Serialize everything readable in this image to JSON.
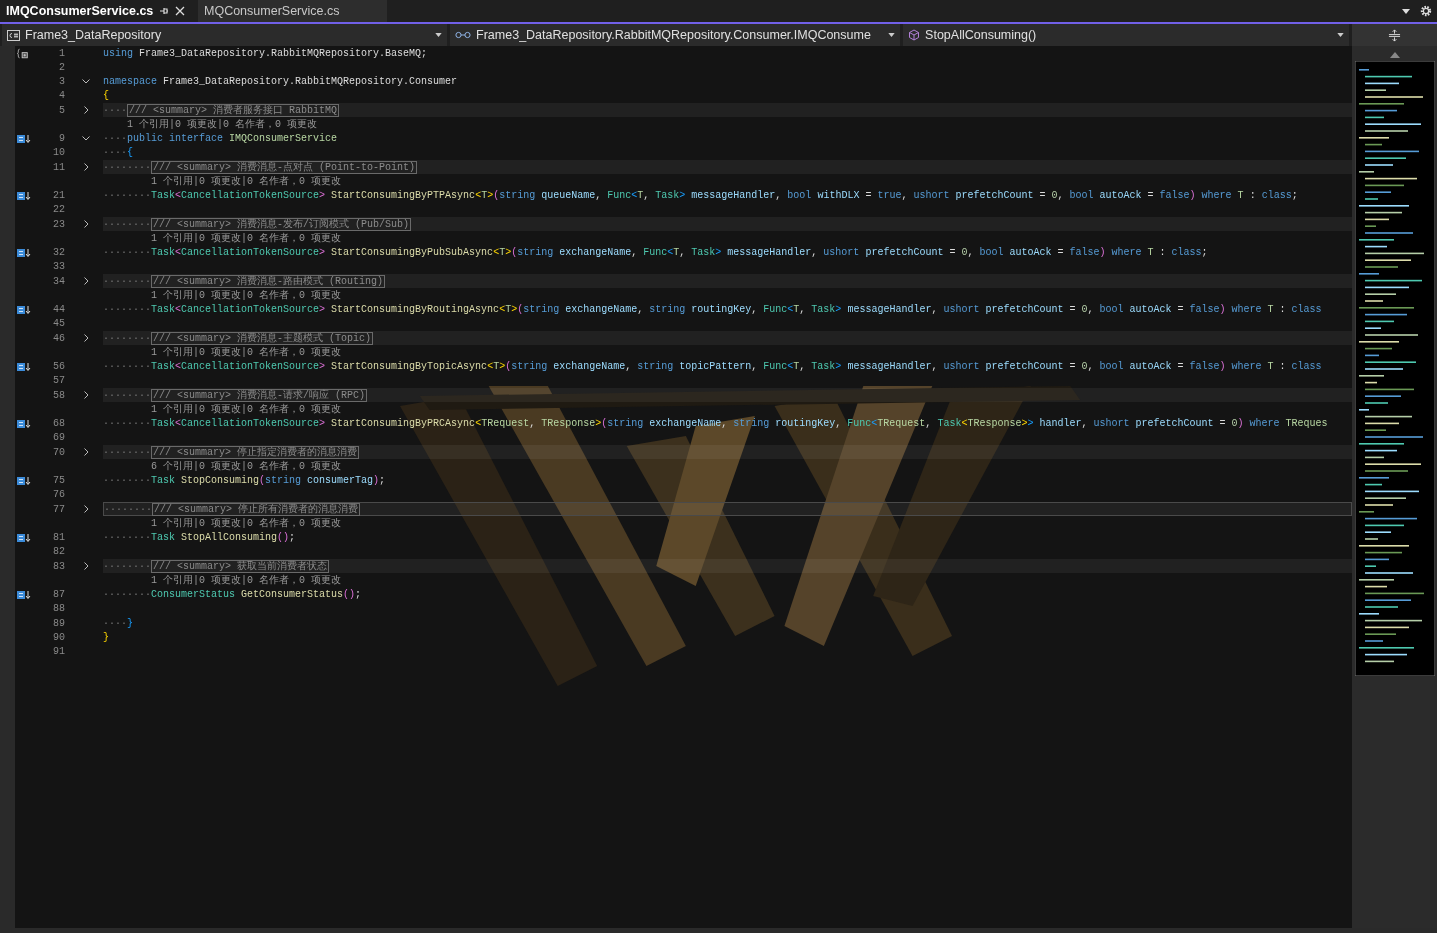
{
  "tabs": [
    {
      "label": "IMQConsumerService.cs",
      "selected": true
    },
    {
      "label": "MQConsumerService.cs",
      "selected": false
    }
  ],
  "navigation": {
    "project": "Frame3_DataRepository",
    "type": "Frame3_DataRepository.RabbitMQRepository.Consumer.IMQConsume",
    "member": "StopAllConsuming()"
  },
  "lines": [
    {
      "number": "1",
      "braces": true,
      "tokens": [
        {
          "text": "using ",
          "kind": "keyword"
        },
        {
          "text": "Frame3_DataRepository.RabbitMQRepository.BaseMQ;",
          "kind": "plain"
        }
      ]
    },
    {
      "number": "2"
    },
    {
      "number": "3",
      "expanded": true,
      "tokens": [
        {
          "text": "namespace ",
          "kind": "keyword"
        },
        {
          "text": "Frame3_DataRepository.RabbitMQRepository.Consumer",
          "kind": "plain"
        }
      ]
    },
    {
      "number": "4",
      "tokens": [
        {
          "text": "{",
          "kind": "gold"
        }
      ]
    },
    {
      "number": "5",
      "expanded": false,
      "tokens": [
        {
          "text": "····",
          "kind": "space"
        },
        {
          "text": "/// <summary> 消费者服务接口 RabbitMQ",
          "kind": "summary"
        }
      ],
      "lens": "1 个引用|0 项更改|0 名作者，0 项更改"
    },
    {
      "number": "9",
      "expanded": true,
      "implementation": true,
      "tokens": [
        {
          "text": "····",
          "kind": "space"
        },
        {
          "text": "public interface ",
          "kind": "keyword"
        },
        {
          "text": "IMQConsumerService",
          "kind": "iface"
        }
      ]
    },
    {
      "number": "10",
      "tokens": [
        {
          "text": "····",
          "kind": "space"
        },
        {
          "text": "{",
          "kind": "blue"
        }
      ]
    },
    {
      "number": "11",
      "expanded": false,
      "tokens": [
        {
          "text": "········",
          "kind": "space"
        },
        {
          "text": "/// <summary> 消费消息-点对点 (Point-to-Point)",
          "kind": "summary"
        }
      ],
      "lens": "1 个引用|0 项更改|0 名作者，0 项更改"
    },
    {
      "number": "21",
      "implementation": true,
      "tokens": [
        {
          "text": "········",
          "kind": "space"
        },
        {
          "text": "Task",
          "kind": "type"
        },
        {
          "text": "<",
          "kind": "pink"
        },
        {
          "text": "CancellationTokenSource",
          "kind": "type"
        },
        {
          "text": "> ",
          "kind": "pink"
        },
        {
          "text": "StartConsumingByPTPAsync",
          "kind": "method"
        },
        {
          "text": "<",
          "kind": "gold"
        },
        {
          "text": "T",
          "kind": "iface"
        },
        {
          "text": ">",
          "kind": "gold"
        },
        {
          "text": "(",
          "kind": "pink"
        },
        {
          "text": "string ",
          "kind": "keyword"
        },
        {
          "text": "queueName",
          "kind": "param"
        },
        {
          "text": ", ",
          "kind": "plain"
        },
        {
          "text": "Func",
          "kind": "type"
        },
        {
          "text": "<",
          "kind": "blue"
        },
        {
          "text": "T",
          "kind": "iface"
        },
        {
          "text": ", ",
          "kind": "plain"
        },
        {
          "text": "Task",
          "kind": "type"
        },
        {
          "text": "> ",
          "kind": "blue"
        },
        {
          "text": "messageHandler",
          "kind": "param"
        },
        {
          "text": ", ",
          "kind": "plain"
        },
        {
          "text": "bool ",
          "kind": "keyword"
        },
        {
          "text": "withDLX",
          "kind": "param"
        },
        {
          "text": " = ",
          "kind": "plain"
        },
        {
          "text": "true",
          "kind": "keyword"
        },
        {
          "text": ", ",
          "kind": "plain"
        },
        {
          "text": "ushort ",
          "kind": "keyword"
        },
        {
          "text": "prefetchCount",
          "kind": "param"
        },
        {
          "text": " = ",
          "kind": "plain"
        },
        {
          "text": "0",
          "kind": "number"
        },
        {
          "text": ", ",
          "kind": "plain"
        },
        {
          "text": "bool ",
          "kind": "keyword"
        },
        {
          "text": "autoAck",
          "kind": "param"
        },
        {
          "text": " = ",
          "kind": "plain"
        },
        {
          "text": "false",
          "kind": "keyword"
        },
        {
          "text": ") ",
          "kind": "pink"
        },
        {
          "text": "where ",
          "kind": "keyword"
        },
        {
          "text": "T",
          "kind": "iface"
        },
        {
          "text": " : ",
          "kind": "plain"
        },
        {
          "text": "class",
          "kind": "keyword"
        },
        {
          "text": ";",
          "kind": "plain"
        }
      ]
    },
    {
      "number": "22"
    },
    {
      "number": "23",
      "expanded": false,
      "tokens": [
        {
          "text": "········",
          "kind": "space"
        },
        {
          "text": "/// <summary> 消费消息-发布/订阅模式 (Pub/Sub)",
          "kind": "summary"
        }
      ],
      "lens": "1 个引用|0 项更改|0 名作者，0 项更改"
    },
    {
      "number": "32",
      "implementation": true,
      "tokens": [
        {
          "text": "········",
          "kind": "space"
        },
        {
          "text": "Task",
          "kind": "type"
        },
        {
          "text": "<",
          "kind": "pink"
        },
        {
          "text": "CancellationTokenSource",
          "kind": "type"
        },
        {
          "text": "> ",
          "kind": "pink"
        },
        {
          "text": "StartConsumingByPubSubAsync",
          "kind": "method"
        },
        {
          "text": "<",
          "kind": "gold"
        },
        {
          "text": "T",
          "kind": "iface"
        },
        {
          "text": ">",
          "kind": "gold"
        },
        {
          "text": "(",
          "kind": "pink"
        },
        {
          "text": "string ",
          "kind": "keyword"
        },
        {
          "text": "exchangeName",
          "kind": "param"
        },
        {
          "text": ", ",
          "kind": "plain"
        },
        {
          "text": "Func",
          "kind": "type"
        },
        {
          "text": "<",
          "kind": "blue"
        },
        {
          "text": "T",
          "kind": "iface"
        },
        {
          "text": ", ",
          "kind": "plain"
        },
        {
          "text": "Task",
          "kind": "type"
        },
        {
          "text": "> ",
          "kind": "blue"
        },
        {
          "text": "messageHandler",
          "kind": "param"
        },
        {
          "text": ", ",
          "kind": "plain"
        },
        {
          "text": "ushort ",
          "kind": "keyword"
        },
        {
          "text": "prefetchCount",
          "kind": "param"
        },
        {
          "text": " = ",
          "kind": "plain"
        },
        {
          "text": "0",
          "kind": "number"
        },
        {
          "text": ", ",
          "kind": "plain"
        },
        {
          "text": "bool ",
          "kind": "keyword"
        },
        {
          "text": "autoAck",
          "kind": "param"
        },
        {
          "text": " = ",
          "kind": "plain"
        },
        {
          "text": "false",
          "kind": "keyword"
        },
        {
          "text": ") ",
          "kind": "pink"
        },
        {
          "text": "where ",
          "kind": "keyword"
        },
        {
          "text": "T",
          "kind": "iface"
        },
        {
          "text": " : ",
          "kind": "plain"
        },
        {
          "text": "class",
          "kind": "keyword"
        },
        {
          "text": ";",
          "kind": "plain"
        }
      ]
    },
    {
      "number": "33"
    },
    {
      "number": "34",
      "expanded": false,
      "tokens": [
        {
          "text": "········",
          "kind": "space"
        },
        {
          "text": "/// <summary> 消费消息-路由模式 (Routing)",
          "kind": "summary"
        }
      ],
      "lens": "1 个引用|0 项更改|0 名作者，0 项更改"
    },
    {
      "number": "44",
      "implementation": true,
      "tokens": [
        {
          "text": "········",
          "kind": "space"
        },
        {
          "text": "Task",
          "kind": "type"
        },
        {
          "text": "<",
          "kind": "pink"
        },
        {
          "text": "CancellationTokenSource",
          "kind": "type"
        },
        {
          "text": "> ",
          "kind": "pink"
        },
        {
          "text": "StartConsumingByRoutingAsync",
          "kind": "method"
        },
        {
          "text": "<",
          "kind": "gold"
        },
        {
          "text": "T",
          "kind": "iface"
        },
        {
          "text": ">",
          "kind": "gold"
        },
        {
          "text": "(",
          "kind": "pink"
        },
        {
          "text": "string ",
          "kind": "keyword"
        },
        {
          "text": "exchangeName",
          "kind": "param"
        },
        {
          "text": ", ",
          "kind": "plain"
        },
        {
          "text": "string ",
          "kind": "keyword"
        },
        {
          "text": "routingKey",
          "kind": "param"
        },
        {
          "text": ", ",
          "kind": "plain"
        },
        {
          "text": "Func",
          "kind": "type"
        },
        {
          "text": "<",
          "kind": "blue"
        },
        {
          "text": "T",
          "kind": "iface"
        },
        {
          "text": ", ",
          "kind": "plain"
        },
        {
          "text": "Task",
          "kind": "type"
        },
        {
          "text": "> ",
          "kind": "blue"
        },
        {
          "text": "messageHandler",
          "kind": "param"
        },
        {
          "text": ", ",
          "kind": "plain"
        },
        {
          "text": "ushort ",
          "kind": "keyword"
        },
        {
          "text": "prefetchCount",
          "kind": "param"
        },
        {
          "text": " = ",
          "kind": "plain"
        },
        {
          "text": "0",
          "kind": "number"
        },
        {
          "text": ", ",
          "kind": "plain"
        },
        {
          "text": "bool ",
          "kind": "keyword"
        },
        {
          "text": "autoAck",
          "kind": "param"
        },
        {
          "text": " = ",
          "kind": "plain"
        },
        {
          "text": "false",
          "kind": "keyword"
        },
        {
          "text": ") ",
          "kind": "pink"
        },
        {
          "text": "where ",
          "kind": "keyword"
        },
        {
          "text": "T",
          "kind": "iface"
        },
        {
          "text": " : ",
          "kind": "plain"
        },
        {
          "text": "class",
          "kind": "keyword"
        }
      ]
    },
    {
      "number": "45"
    },
    {
      "number": "46",
      "expanded": false,
      "tokens": [
        {
          "text": "········",
          "kind": "space"
        },
        {
          "text": "/// <summary> 消费消息-主题模式 (Topic)",
          "kind": "summary"
        }
      ],
      "lens": "1 个引用|0 项更改|0 名作者，0 项更改"
    },
    {
      "number": "56",
      "implementation": true,
      "tokens": [
        {
          "text": "········",
          "kind": "space"
        },
        {
          "text": "Task",
          "kind": "type"
        },
        {
          "text": "<",
          "kind": "pink"
        },
        {
          "text": "CancellationTokenSource",
          "kind": "type"
        },
        {
          "text": "> ",
          "kind": "pink"
        },
        {
          "text": "StartConsumingByTopicAsync",
          "kind": "method"
        },
        {
          "text": "<",
          "kind": "gold"
        },
        {
          "text": "T",
          "kind": "iface"
        },
        {
          "text": ">",
          "kind": "gold"
        },
        {
          "text": "(",
          "kind": "pink"
        },
        {
          "text": "string ",
          "kind": "keyword"
        },
        {
          "text": "exchangeName",
          "kind": "param"
        },
        {
          "text": ", ",
          "kind": "plain"
        },
        {
          "text": "string ",
          "kind": "keyword"
        },
        {
          "text": "topicPattern",
          "kind": "param"
        },
        {
          "text": ", ",
          "kind": "plain"
        },
        {
          "text": "Func",
          "kind": "type"
        },
        {
          "text": "<",
          "kind": "blue"
        },
        {
          "text": "T",
          "kind": "iface"
        },
        {
          "text": ", ",
          "kind": "plain"
        },
        {
          "text": "Task",
          "kind": "type"
        },
        {
          "text": "> ",
          "kind": "blue"
        },
        {
          "text": "messageHandler",
          "kind": "param"
        },
        {
          "text": ", ",
          "kind": "plain"
        },
        {
          "text": "ushort ",
          "kind": "keyword"
        },
        {
          "text": "prefetchCount",
          "kind": "param"
        },
        {
          "text": " = ",
          "kind": "plain"
        },
        {
          "text": "0",
          "kind": "number"
        },
        {
          "text": ", ",
          "kind": "plain"
        },
        {
          "text": "bool ",
          "kind": "keyword"
        },
        {
          "text": "autoAck",
          "kind": "param"
        },
        {
          "text": " = ",
          "kind": "plain"
        },
        {
          "text": "false",
          "kind": "keyword"
        },
        {
          "text": ") ",
          "kind": "pink"
        },
        {
          "text": "where ",
          "kind": "keyword"
        },
        {
          "text": "T",
          "kind": "iface"
        },
        {
          "text": " : ",
          "kind": "plain"
        },
        {
          "text": "class",
          "kind": "keyword"
        }
      ]
    },
    {
      "number": "57"
    },
    {
      "number": "58",
      "expanded": false,
      "tokens": [
        {
          "text": "········",
          "kind": "space"
        },
        {
          "text": "/// <summary> 消费消息-请求/响应 (RPC)",
          "kind": "summary"
        }
      ],
      "lens": "1 个引用|0 项更改|0 名作者，0 项更改"
    },
    {
      "number": "68",
      "implementation": true,
      "tokens": [
        {
          "text": "········",
          "kind": "space"
        },
        {
          "text": "Task",
          "kind": "type"
        },
        {
          "text": "<",
          "kind": "pink"
        },
        {
          "text": "CancellationTokenSource",
          "kind": "type"
        },
        {
          "text": "> ",
          "kind": "pink"
        },
        {
          "text": "StartConsumingByPRCAsync",
          "kind": "method"
        },
        {
          "text": "<",
          "kind": "gold"
        },
        {
          "text": "TRequest",
          "kind": "iface"
        },
        {
          "text": ", ",
          "kind": "plain"
        },
        {
          "text": "TResponse",
          "kind": "iface"
        },
        {
          "text": ">",
          "kind": "gold"
        },
        {
          "text": "(",
          "kind": "pink"
        },
        {
          "text": "string ",
          "kind": "keyword"
        },
        {
          "text": "exchangeName",
          "kind": "param"
        },
        {
          "text": ", ",
          "kind": "plain"
        },
        {
          "text": "string ",
          "kind": "keyword"
        },
        {
          "text": "routingKey",
          "kind": "param"
        },
        {
          "text": ", ",
          "kind": "plain"
        },
        {
          "text": "Func",
          "kind": "type"
        },
        {
          "text": "<",
          "kind": "blue"
        },
        {
          "text": "TRequest",
          "kind": "iface"
        },
        {
          "text": ", ",
          "kind": "plain"
        },
        {
          "text": "Task",
          "kind": "type"
        },
        {
          "text": "<",
          "kind": "gold"
        },
        {
          "text": "TResponse",
          "kind": "iface"
        },
        {
          "text": ">",
          "kind": "gold"
        },
        {
          "text": "> ",
          "kind": "blue"
        },
        {
          "text": "handler",
          "kind": "param"
        },
        {
          "text": ", ",
          "kind": "plain"
        },
        {
          "text": "ushort ",
          "kind": "keyword"
        },
        {
          "text": "prefetchCount",
          "kind": "param"
        },
        {
          "text": " = ",
          "kind": "plain"
        },
        {
          "text": "0",
          "kind": "number"
        },
        {
          "text": ") ",
          "kind": "pink"
        },
        {
          "text": "where ",
          "kind": "keyword"
        },
        {
          "text": "TReques",
          "kind": "iface"
        }
      ]
    },
    {
      "number": "69"
    },
    {
      "number": "70",
      "expanded": false,
      "tokens": [
        {
          "text": "········",
          "kind": "space"
        },
        {
          "text": "/// <summary> 停止指定消费者的消息消费",
          "kind": "summary"
        }
      ],
      "lens": "6 个引用|0 项更改|0 名作者，0 项更改"
    },
    {
      "number": "75",
      "implementation": true,
      "tokens": [
        {
          "text": "········",
          "kind": "space"
        },
        {
          "text": "Task ",
          "kind": "type"
        },
        {
          "text": "StopConsuming",
          "kind": "method"
        },
        {
          "text": "(",
          "kind": "pink"
        },
        {
          "text": "string ",
          "kind": "keyword"
        },
        {
          "text": "consumerTag",
          "kind": "param"
        },
        {
          "text": ")",
          "kind": "pink"
        },
        {
          "text": ";",
          "kind": "plain"
        }
      ]
    },
    {
      "number": "76"
    },
    {
      "number": "77",
      "expanded": false,
      "current": true,
      "tokens": [
        {
          "text": "········",
          "kind": "space"
        },
        {
          "text": "/// <summary> 停止所有消费者的消息消费",
          "kind": "summary"
        }
      ],
      "lens": "1 个引用|0 项更改|0 名作者，0 项更改"
    },
    {
      "number": "81",
      "implementation": true,
      "tokens": [
        {
          "text": "········",
          "kind": "space"
        },
        {
          "text": "Task ",
          "kind": "type"
        },
        {
          "text": "StopAllConsuming",
          "kind": "method"
        },
        {
          "text": "()",
          "kind": "pink"
        },
        {
          "text": ";",
          "kind": "plain"
        }
      ]
    },
    {
      "number": "82"
    },
    {
      "number": "83",
      "expanded": false,
      "tokens": [
        {
          "text": "········",
          "kind": "space"
        },
        {
          "text": "/// <summary> 获取当前消费者状态",
          "kind": "summary"
        }
      ],
      "lens": "1 个引用|0 项更改|0 名作者，0 项更改"
    },
    {
      "number": "87",
      "implementation": true,
      "tokens": [
        {
          "text": "········",
          "kind": "space"
        },
        {
          "text": "ConsumerStatus ",
          "kind": "type"
        },
        {
          "text": "GetConsumerStatus",
          "kind": "method"
        },
        {
          "text": "()",
          "kind": "pink"
        },
        {
          "text": ";",
          "kind": "plain"
        }
      ]
    },
    {
      "number": "88"
    },
    {
      "number": "89",
      "tokens": [
        {
          "text": "····",
          "kind": "space"
        },
        {
          "text": "}",
          "kind": "blue"
        }
      ]
    },
    {
      "number": "90",
      "tokens": [
        {
          "text": "}",
          "kind": "gold"
        }
      ]
    },
    {
      "number": "91"
    }
  ]
}
